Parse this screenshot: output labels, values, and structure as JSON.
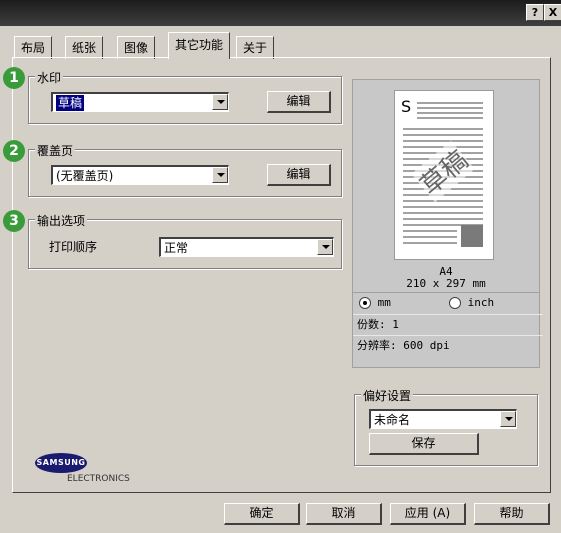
{
  "window": {
    "title_help_glyph": "?",
    "title_close_glyph": "X"
  },
  "tabs": [
    {
      "label": "布局"
    },
    {
      "label": "纸张"
    },
    {
      "label": "图像"
    },
    {
      "label": "其它功能"
    },
    {
      "label": "关于"
    }
  ],
  "watermark": {
    "badge": "1",
    "group_label": "水印",
    "selected": "草稿",
    "edit_label": "编辑"
  },
  "overlay": {
    "badge": "2",
    "group_label": "覆盖页",
    "selected": "(无覆盖页)",
    "edit_label": "编辑"
  },
  "output": {
    "badge": "3",
    "group_label": "输出选项",
    "print_order_label": "打印顺序",
    "print_order_value": "正常"
  },
  "preview": {
    "page_letter": "S",
    "watermark_text": "草稿",
    "paper_name": "A4",
    "paper_size": "210 x 297 mm"
  },
  "info": {
    "unit_mm": "mm",
    "unit_inch": "inch",
    "selected_unit": "mm",
    "copies": "份数: 1",
    "resolution": "分辨率: 600 dpi"
  },
  "favorites": {
    "group_label": "偏好设置",
    "selected": "未命名",
    "save_label": "保存"
  },
  "logo": {
    "brand": "SAMSUNG",
    "sub": "ELECTRONICS"
  },
  "footer": {
    "ok": "确定",
    "cancel": "取消",
    "apply": "应用 (A)",
    "help": "帮助"
  },
  "colors": {
    "badge": "#3a9b3a",
    "selection": "#000080",
    "face": "#d4d0c8",
    "titlebar": "#2a2a2a"
  }
}
